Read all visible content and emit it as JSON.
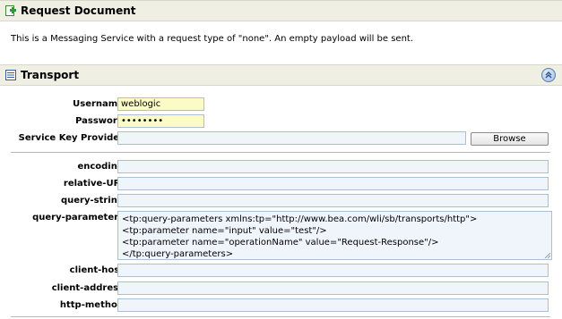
{
  "request_section": {
    "title": "Request Document",
    "description": "This is a Messaging Service with a request type of \"none\". An empty payload will be sent."
  },
  "transport_section": {
    "title": "Transport",
    "fields": {
      "username": {
        "label": "Username:",
        "value": "weblogic"
      },
      "password": {
        "label": "Password:",
        "value": "••••••••"
      },
      "service_key_provider": {
        "label": "Service Key Provider:",
        "value": "",
        "button": "Browse"
      },
      "encoding": {
        "label": "encoding:",
        "value": ""
      },
      "relative_uri": {
        "label": "relative-URI:",
        "value": ""
      },
      "query_string": {
        "label": "query-string:",
        "value": ""
      },
      "query_parameters": {
        "label": "query-parameters:",
        "lines": [
          "<tp:query-parameters xmlns:tp=\"http://www.bea.com/wli/sb/transports/http\">",
          "<tp:parameter name=\"input\" value=\"test\"/>",
          "<tp:parameter name=\"operationName\" value=\"Request-Response\"/>",
          "</tp:query-parameters>"
        ]
      },
      "client_host": {
        "label": "client-host:",
        "value": ""
      },
      "client_address": {
        "label": "client-address:",
        "value": ""
      },
      "http_method": {
        "label": "http-method:",
        "value": ""
      }
    }
  },
  "icons": {
    "request": "document-add-icon",
    "transport": "form-icon",
    "collapse": "double-chevron-up-icon"
  },
  "colors": {
    "header_bg": "#f0efe4",
    "field_bg": "#f0f4fb",
    "field_border": "#a9bfd3",
    "credential_bg": "#fbfbc8"
  }
}
